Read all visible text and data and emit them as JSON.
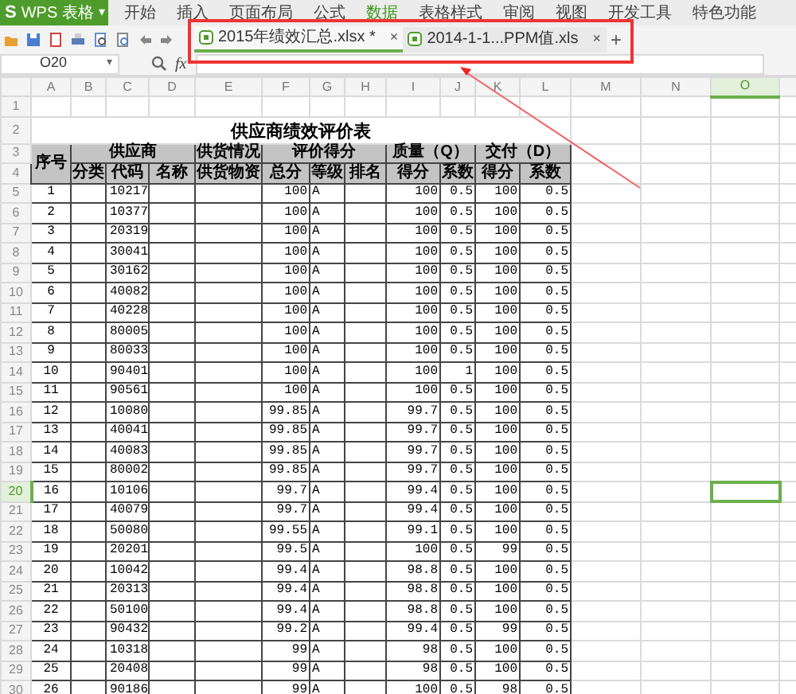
{
  "app": {
    "logo": "S",
    "name": "WPS 表格",
    "caret": "▾"
  },
  "menu": [
    {
      "label": "开始",
      "selected": false
    },
    {
      "label": "插入",
      "selected": false
    },
    {
      "label": "页面布局",
      "selected": false
    },
    {
      "label": "公式",
      "selected": false
    },
    {
      "label": "数据",
      "selected": true
    },
    {
      "label": "表格样式",
      "selected": false
    },
    {
      "label": "审阅",
      "selected": false
    },
    {
      "label": "视图",
      "selected": false
    },
    {
      "label": "开发工具",
      "selected": false
    },
    {
      "label": "特色功能",
      "selected": false
    }
  ],
  "tabs": [
    {
      "label": "2015年绩效汇总.xlsx *",
      "selected": true,
      "close": "×"
    },
    {
      "label": "2014-1-1...PPM值.xls",
      "selected": false,
      "close": "×"
    }
  ],
  "new_tab": "+",
  "formula_bar": {
    "cell_name": "O20",
    "caret": "▾",
    "fx": "fx"
  },
  "sheet": {
    "columns": [
      {
        "label": "A",
        "selected": false
      },
      {
        "label": "B",
        "selected": false
      },
      {
        "label": "C",
        "selected": false
      },
      {
        "label": "D",
        "selected": false
      },
      {
        "label": "E",
        "selected": false
      },
      {
        "label": "F",
        "selected": false
      },
      {
        "label": "G",
        "selected": false
      },
      {
        "label": "H",
        "selected": false
      },
      {
        "label": "I",
        "selected": false
      },
      {
        "label": "J",
        "selected": false
      },
      {
        "label": "K",
        "selected": false
      },
      {
        "label": "L",
        "selected": false
      },
      {
        "label": "M",
        "selected": false
      },
      {
        "label": "N",
        "selected": false
      },
      {
        "label": "O",
        "selected": true
      }
    ],
    "row_numbers": [
      {
        "label": "1",
        "selected": false
      },
      {
        "label": "2",
        "selected": false
      },
      {
        "label": "3",
        "selected": false
      },
      {
        "label": "4",
        "selected": false
      },
      {
        "label": "5",
        "selected": false
      },
      {
        "label": "6",
        "selected": false
      },
      {
        "label": "7",
        "selected": false
      },
      {
        "label": "8",
        "selected": false
      },
      {
        "label": "9",
        "selected": false
      },
      {
        "label": "10",
        "selected": false
      },
      {
        "label": "11",
        "selected": false
      },
      {
        "label": "12",
        "selected": false
      },
      {
        "label": "13",
        "selected": false
      },
      {
        "label": "14",
        "selected": false
      },
      {
        "label": "15",
        "selected": false
      },
      {
        "label": "16",
        "selected": false
      },
      {
        "label": "17",
        "selected": false
      },
      {
        "label": "18",
        "selected": false
      },
      {
        "label": "19",
        "selected": false
      },
      {
        "label": "20",
        "selected": true
      },
      {
        "label": "21",
        "selected": false
      },
      {
        "label": "22",
        "selected": false
      },
      {
        "label": "23",
        "selected": false
      },
      {
        "label": "24",
        "selected": false
      },
      {
        "label": "25",
        "selected": false
      },
      {
        "label": "26",
        "selected": false
      },
      {
        "label": "27",
        "selected": false
      },
      {
        "label": "28",
        "selected": false
      },
      {
        "label": "29",
        "selected": false
      },
      {
        "label": "30",
        "selected": false
      }
    ],
    "title": "供应商绩效评价表",
    "header_top": [
      "序号",
      "供应商",
      "供货情况",
      "评价得分",
      "质量（Q）",
      "交付（D）"
    ],
    "header_sub": [
      "分类",
      "代码",
      "名称",
      "供货物资",
      "总分",
      "等级",
      "排名",
      "得分",
      "系数",
      "得分",
      "系数"
    ],
    "rows": [
      {
        "seq": "1",
        "code": "10217",
        "total": "100",
        "grade": "A",
        "q_score": "100",
        "q_coef": "0.5",
        "d_score": "100",
        "d_coef": "0.5"
      },
      {
        "seq": "2",
        "code": "10377",
        "total": "100",
        "grade": "A",
        "q_score": "100",
        "q_coef": "0.5",
        "d_score": "100",
        "d_coef": "0.5"
      },
      {
        "seq": "3",
        "code": "20319",
        "total": "100",
        "grade": "A",
        "q_score": "100",
        "q_coef": "0.5",
        "d_score": "100",
        "d_coef": "0.5"
      },
      {
        "seq": "4",
        "code": "30041",
        "total": "100",
        "grade": "A",
        "q_score": "100",
        "q_coef": "0.5",
        "d_score": "100",
        "d_coef": "0.5"
      },
      {
        "seq": "5",
        "code": "30162",
        "total": "100",
        "grade": "A",
        "q_score": "100",
        "q_coef": "0.5",
        "d_score": "100",
        "d_coef": "0.5"
      },
      {
        "seq": "6",
        "code": "40082",
        "total": "100",
        "grade": "A",
        "q_score": "100",
        "q_coef": "0.5",
        "d_score": "100",
        "d_coef": "0.5"
      },
      {
        "seq": "7",
        "code": "40228",
        "total": "100",
        "grade": "A",
        "q_score": "100",
        "q_coef": "0.5",
        "d_score": "100",
        "d_coef": "0.5"
      },
      {
        "seq": "8",
        "code": "80005",
        "total": "100",
        "grade": "A",
        "q_score": "100",
        "q_coef": "0.5",
        "d_score": "100",
        "d_coef": "0.5"
      },
      {
        "seq": "9",
        "code": "80033",
        "total": "100",
        "grade": "A",
        "q_score": "100",
        "q_coef": "0.5",
        "d_score": "100",
        "d_coef": "0.5"
      },
      {
        "seq": "10",
        "code": "90401",
        "total": "100",
        "grade": "A",
        "q_score": "100",
        "q_coef": "1",
        "d_score": "100",
        "d_coef": "0.5"
      },
      {
        "seq": "11",
        "code": "90561",
        "total": "100",
        "grade": "A",
        "q_score": "100",
        "q_coef": "0.5",
        "d_score": "100",
        "d_coef": "0.5"
      },
      {
        "seq": "12",
        "code": "10080",
        "total": "99.85",
        "grade": "A",
        "q_score": "99.7",
        "q_coef": "0.5",
        "d_score": "100",
        "d_coef": "0.5"
      },
      {
        "seq": "13",
        "code": "40041",
        "total": "99.85",
        "grade": "A",
        "q_score": "99.7",
        "q_coef": "0.5",
        "d_score": "100",
        "d_coef": "0.5"
      },
      {
        "seq": "14",
        "code": "40083",
        "total": "99.85",
        "grade": "A",
        "q_score": "99.7",
        "q_coef": "0.5",
        "d_score": "100",
        "d_coef": "0.5"
      },
      {
        "seq": "15",
        "code": "80002",
        "total": "99.85",
        "grade": "A",
        "q_score": "99.7",
        "q_coef": "0.5",
        "d_score": "100",
        "d_coef": "0.5"
      },
      {
        "seq": "16",
        "code": "10106",
        "total": "99.7",
        "grade": "A",
        "q_score": "99.4",
        "q_coef": "0.5",
        "d_score": "100",
        "d_coef": "0.5"
      },
      {
        "seq": "17",
        "code": "40079",
        "total": "99.7",
        "grade": "A",
        "q_score": "99.4",
        "q_coef": "0.5",
        "d_score": "100",
        "d_coef": "0.5"
      },
      {
        "seq": "18",
        "code": "50080",
        "total": "99.55",
        "grade": "A",
        "q_score": "99.1",
        "q_coef": "0.5",
        "d_score": "100",
        "d_coef": "0.5"
      },
      {
        "seq": "19",
        "code": "20201",
        "total": "99.5",
        "grade": "A",
        "q_score": "100",
        "q_coef": "0.5",
        "d_score": "99",
        "d_coef": "0.5"
      },
      {
        "seq": "20",
        "code": "10042",
        "total": "99.4",
        "grade": "A",
        "q_score": "98.8",
        "q_coef": "0.5",
        "d_score": "100",
        "d_coef": "0.5"
      },
      {
        "seq": "21",
        "code": "20313",
        "total": "99.4",
        "grade": "A",
        "q_score": "98.8",
        "q_coef": "0.5",
        "d_score": "100",
        "d_coef": "0.5"
      },
      {
        "seq": "22",
        "code": "50100",
        "total": "99.4",
        "grade": "A",
        "q_score": "98.8",
        "q_coef": "0.5",
        "d_score": "100",
        "d_coef": "0.5"
      },
      {
        "seq": "23",
        "code": "90432",
        "total": "99.2",
        "grade": "A",
        "q_score": "99.4",
        "q_coef": "0.5",
        "d_score": "99",
        "d_coef": "0.5"
      },
      {
        "seq": "24",
        "code": "10318",
        "total": "99",
        "grade": "A",
        "q_score": "98",
        "q_coef": "0.5",
        "d_score": "100",
        "d_coef": "0.5"
      },
      {
        "seq": "25",
        "code": "20408",
        "total": "99",
        "grade": "A",
        "q_score": "98",
        "q_coef": "0.5",
        "d_score": "100",
        "d_coef": "0.5"
      },
      {
        "seq": "26",
        "code": "90186",
        "total": "99",
        "grade": "A",
        "q_score": "100",
        "q_coef": "0.5",
        "d_score": "98",
        "d_coef": "0.5"
      }
    ]
  }
}
